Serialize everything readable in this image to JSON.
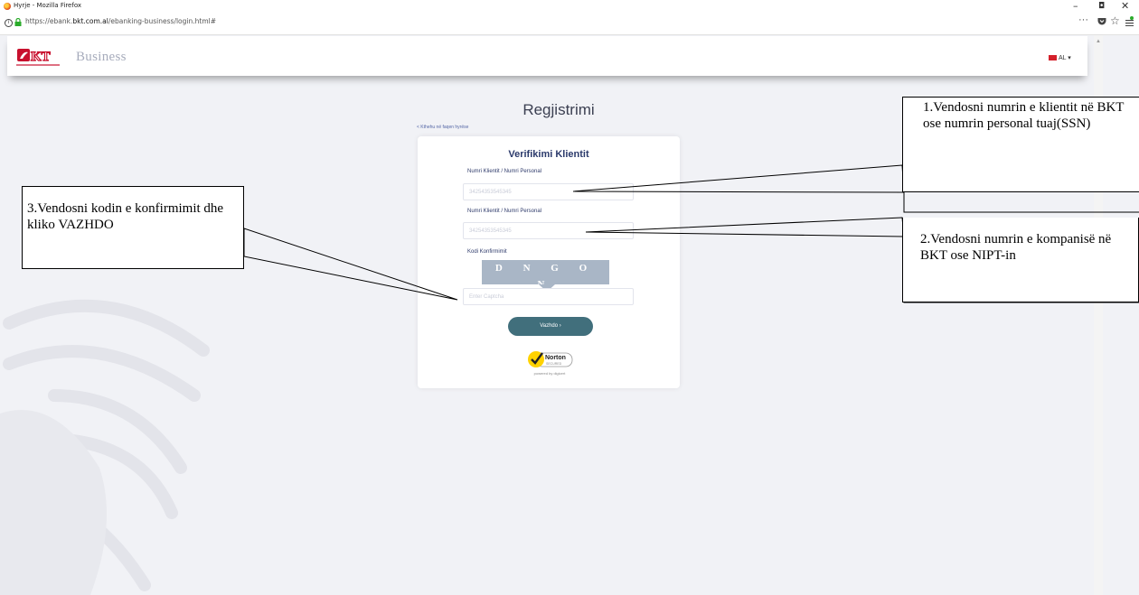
{
  "browser": {
    "window_title": "Hyrje - Mozilla Firefox",
    "url_prefix": "https://ebank.",
    "url_domain": "bkt.com.al",
    "url_path": "/ebanking-business/login.html#",
    "menu_dots": "···",
    "minimize": "–",
    "maximize": "◘",
    "close": "✕"
  },
  "header": {
    "brand_text": "Business",
    "language": "AL ▾"
  },
  "page": {
    "title": "Regjistrimi",
    "back_link": "< Kthehu në faqen hyrëse"
  },
  "form": {
    "title": "Verifikimi Klientit",
    "field1_label": "Numri Klientit / Numri Personal",
    "field1_placeholder": "34254353545345",
    "field2_label": "Numri Klientit / Numri Personal",
    "field2_placeholder": "34254353545345",
    "captcha_label": "Kodi Konfirmimit",
    "captcha_text": "D N G O N",
    "captcha_placeholder": "Enter Captcha",
    "continue_button": "Vazhdo ›"
  },
  "norton": {
    "badge": "Norton",
    "sub": "SECURED",
    "powered": "powered by digicert"
  },
  "callouts": {
    "step1": "1.Vendosni numrin e klientit në BKT ose numrin personal tuaj(SSN)",
    "step2": "2.Vendosni numrin e kompanisë në BKT ose NIPT-in",
    "step3": "3.Vendosni kodin e konfirmimit dhe kliko VAZHDO"
  },
  "colors": {
    "page_bg": "#f1f2f6",
    "button": "#416f7c",
    "brand_red": "#c8102e",
    "form_title": "#2b3a6b"
  }
}
